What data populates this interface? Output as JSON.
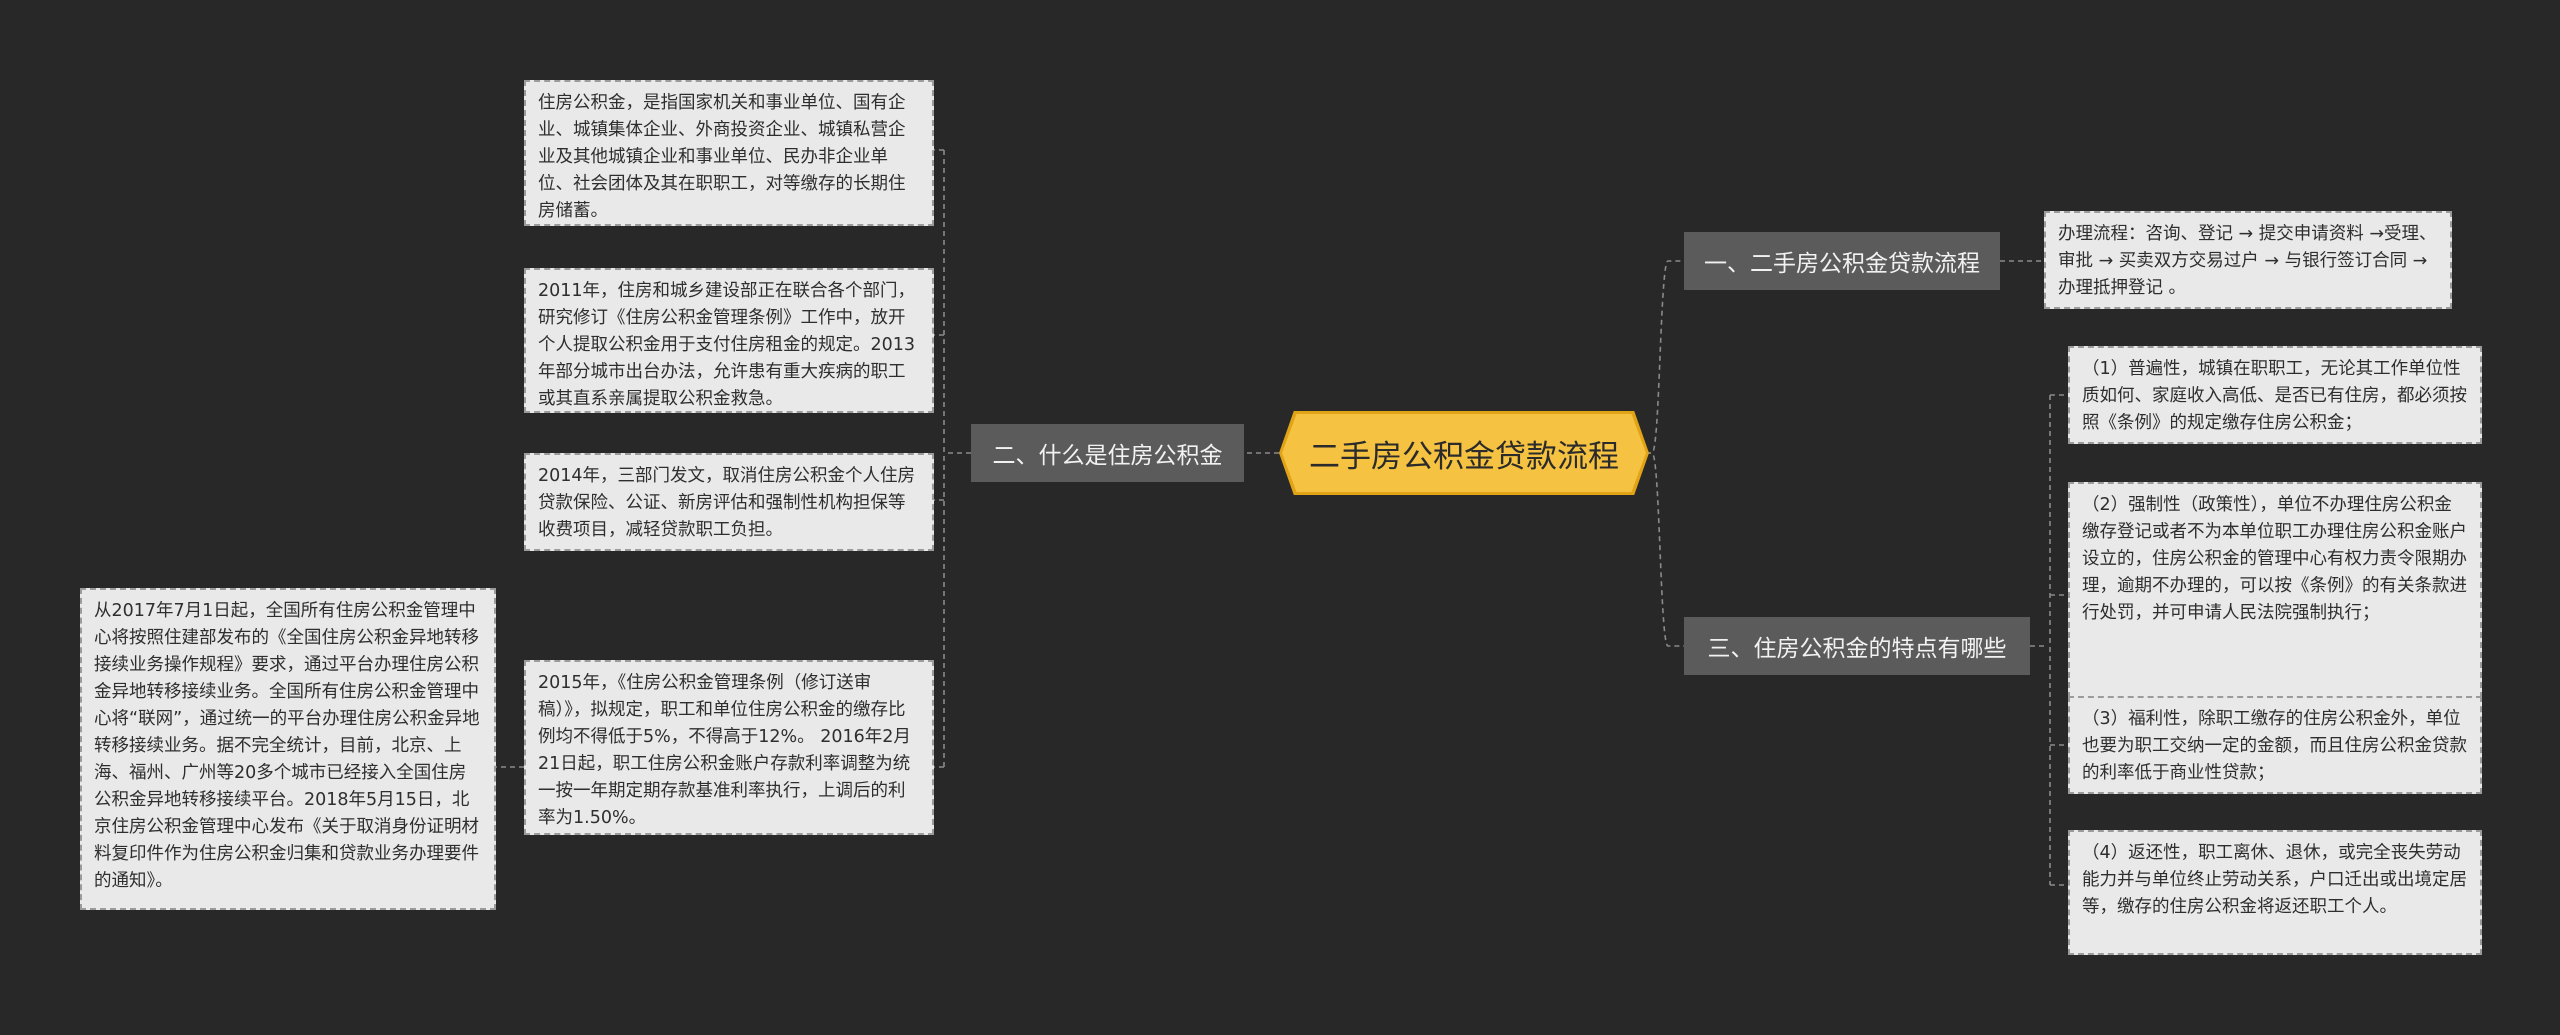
{
  "root": {
    "title": "二手房公积金贷款流程"
  },
  "branches": [
    {
      "label": "一、二手房公积金贷款流程"
    },
    {
      "label": "二、什么是住房公积金"
    },
    {
      "label": "三、住房公积金的特点有哪些"
    }
  ],
  "leaves": {
    "b1": [
      "办理流程：咨询、登记 → 提交申请资料 →受理、审批 → 买卖双方交易过户 → 与银行签订合同 → 办理抵押登记 。"
    ],
    "b2": [
      "住房公积金，是指国家机关和事业单位、国有企业、城镇集体企业、外商投资企业、城镇私营企业及其他城镇企业和事业单位、民办非企业单位、社会团体及其在职职工，对等缴存的长期住房储蓄。",
      "2011年，住房和城乡建设部正在联合各个部门，研究修订《住房公积金管理条例》工作中，放开个人提取公积金用于支付住房租金的规定。2013年部分城市出台办法，允许患有重大疾病的职工或其直系亲属提取公积金救急。",
      "2014年，三部门发文，取消住房公积金个人住房贷款保险、公证、新房评估和强制性机构担保等收费项目，减轻贷款职工负担。",
      "2015年，《住房公积金管理条例（修订送审稿）》，拟规定，职工和单位住房公积金的缴存比例均不得低于5%，不得高于12%。 2016年2月21日起，职工住房公积金账户存款利率调整为统一按一年期定期存款基准利率执行，上调后的利率为1.50%。",
      "从2017年7月1日起，全国所有住房公积金管理中心将按照住建部发布的《全国住房公积金异地转移接续业务操作规程》要求，通过平台办理住房公积金异地转移接续业务。全国所有住房公积金管理中心将“联网”，通过统一的平台办理住房公积金异地转移接续业务。据不完全统计，目前，北京、上海、福州、广州等20多个城市已经接入全国住房公积金异地转移接续平台。2018年5月15日，北京住房公积金管理中心发布《关于取消身份证明材料复印件作为住房公积金归集和贷款业务办理要件的通知》。"
    ],
    "b3": [
      "（1）普遍性，城镇在职职工，无论其工作单位性质如何、家庭收入高低、是否已有住房，都必须按照《条例》的规定缴存住房公积金；",
      "（2）强制性（政策性），单位不办理住房公积金缴存登记或者不为本单位职工办理住房公积金账户设立的，住房公积金的管理中心有权力责令限期办理，逾期不办理的，可以按《条例》的有关条款进行处罚，并可申请人民法院强制执行；",
      "（3）福利性，除职工缴存的住房公积金外，单位也要为职工交纳一定的金额，而且住房公积金贷款的利率低于商业性贷款；",
      "（4）返还性，职工离休、退休，或完全丧失劳动能力并与单位终止劳动关系，户口迁出或出境定居等，缴存的住房公积金将返还职工个人。"
    ]
  },
  "colors": {
    "background": "#282828",
    "root_fill": "#f5c242",
    "branch_fill": "#5b5b5b",
    "leaf_fill": "#e9e9e9",
    "connector": "#8a8a8a"
  }
}
